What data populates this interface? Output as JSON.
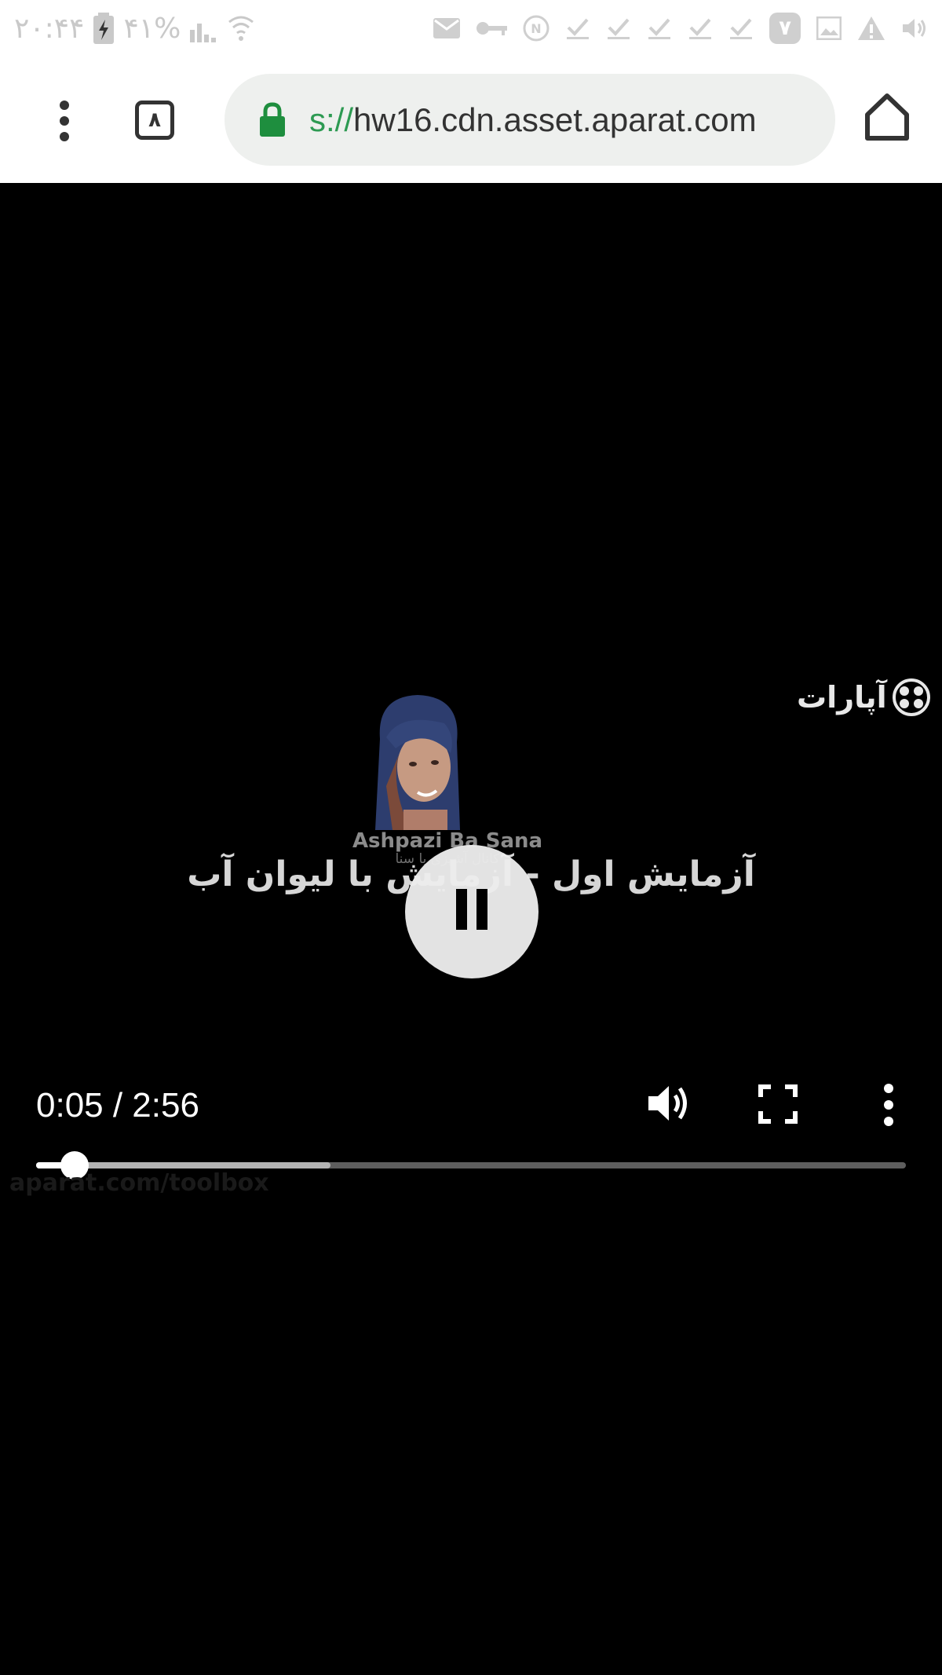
{
  "status_bar": {
    "time": "۲۰:۴۴",
    "battery": "۴۱%",
    "notification_count_badge": "۷"
  },
  "toolbar": {
    "tab_count": "۸",
    "url_scheme": "s://",
    "url_host": "hw16.cdn.asset.aparat.com"
  },
  "video": {
    "logo_text": "آپارات",
    "portrait_caption": "Ashpazi Ba Sana",
    "portrait_subcaption": "کانال آشپزی با سنا",
    "title_overlay": "آزمایش اول - آزمایش با لیوان آب",
    "time_display": "0:05 / 2:56",
    "watermark": "aparat.com/toolbox",
    "progress_played_fraction": 0.044,
    "progress_buffered_fraction": 0.338
  },
  "colors": {
    "secure_green": "#1e8e3e",
    "url_bar_bg": "#eef0ee",
    "video_bg": "#000000"
  }
}
